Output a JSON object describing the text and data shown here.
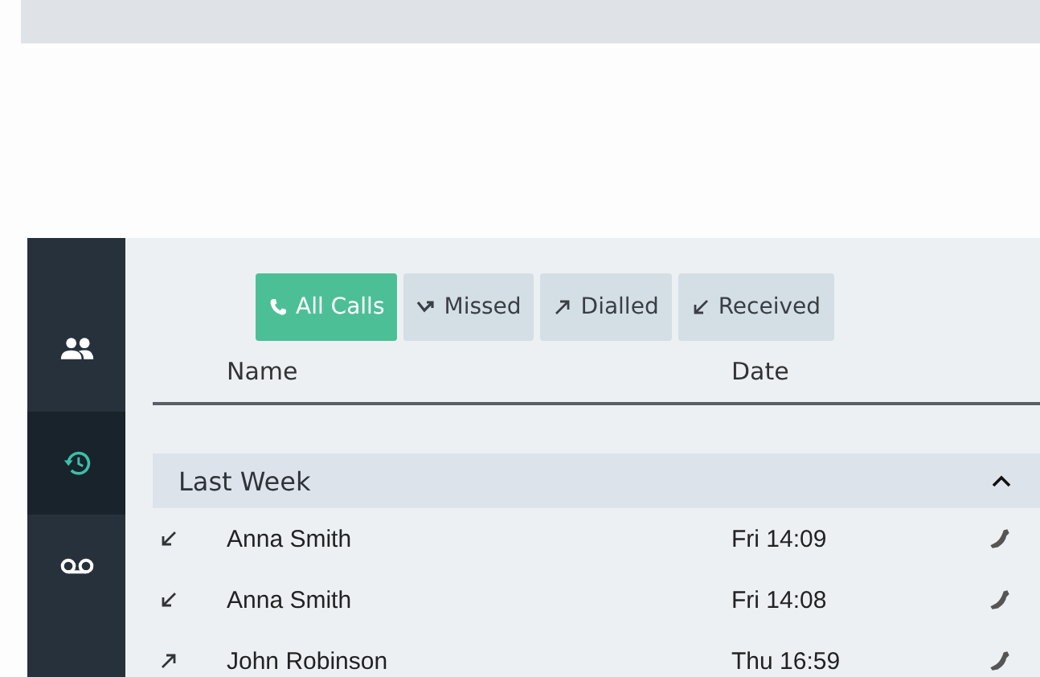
{
  "nav": [
    {
      "kind": "contacts",
      "selected": false
    },
    {
      "kind": "history",
      "selected": true
    },
    {
      "kind": "voicemail",
      "selected": false
    }
  ],
  "filters": [
    {
      "kind": "all",
      "label": "All Calls",
      "selected": true
    },
    {
      "kind": "missed",
      "label": "Missed",
      "selected": false
    },
    {
      "kind": "dialled",
      "label": "Dialled",
      "selected": false
    },
    {
      "kind": "received",
      "label": "Received",
      "selected": false
    }
  ],
  "columns": [
    "Name",
    "Date"
  ],
  "groups": [
    {
      "title": "Last Week",
      "expanded": true,
      "rows": [
        {
          "kind": "received",
          "name": "Anna Smith",
          "date": "Fri 14:09"
        },
        {
          "kind": "received",
          "name": "Anna Smith",
          "date": "Fri 14:08"
        },
        {
          "kind": "dialled",
          "name": "John Robinson",
          "date": "Thu 16:59"
        }
      ]
    }
  ]
}
